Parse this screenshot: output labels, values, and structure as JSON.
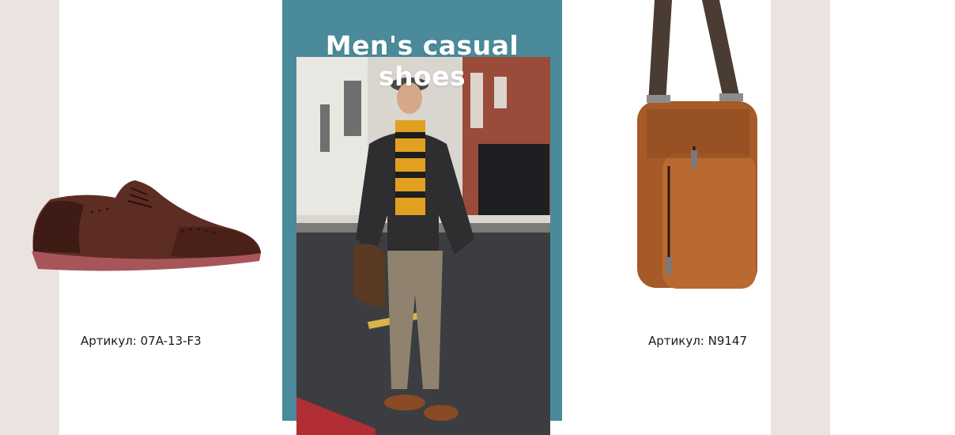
{
  "banner": {
    "title": "Men's casual shoes",
    "left_product": {
      "sku_label": "Артикул: 07A-13-F3",
      "icon": "brogue-shoe-icon"
    },
    "center_image": {
      "icon": "street-style-man-photo"
    },
    "right_product": {
      "sku_label": "Артикул: N9147",
      "icon": "leather-crossbody-bag-icon"
    }
  },
  "colors": {
    "teal": "#4a8a9b",
    "beige": "#ebe3df",
    "shoe_brown": "#5a2e26",
    "bag_tan": "#a55a28"
  }
}
